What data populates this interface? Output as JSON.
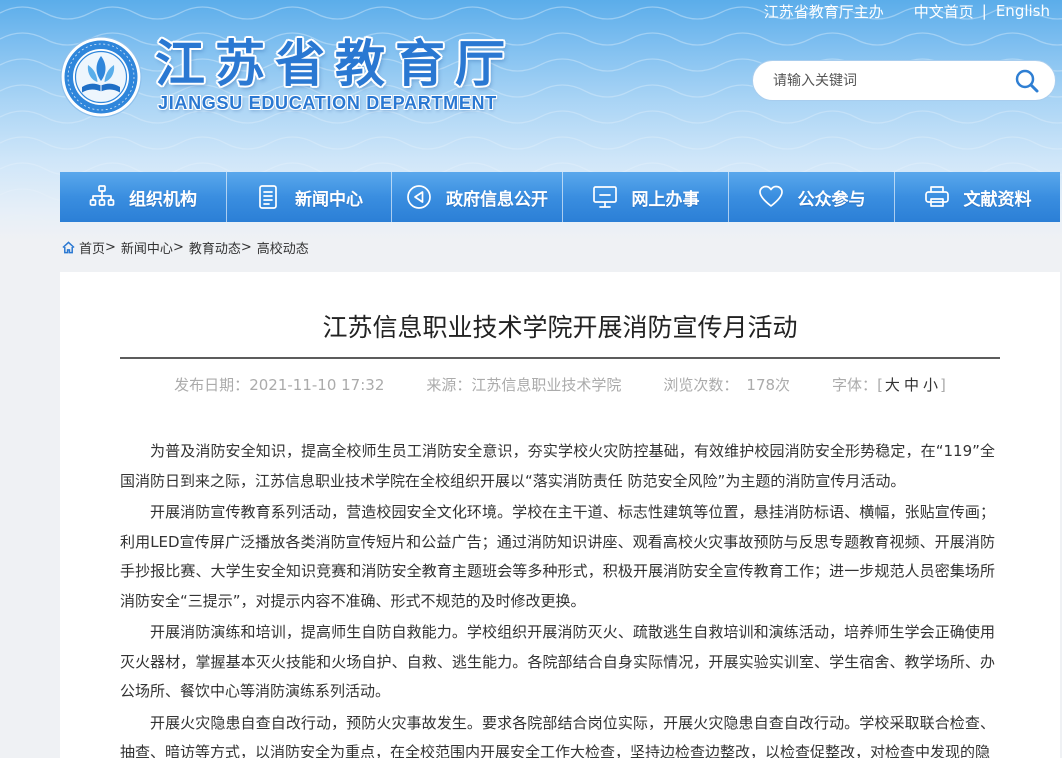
{
  "header": {
    "topbar": {
      "sponsor": "江苏省教育厅主办",
      "home_link": "中文首页",
      "divider": "|",
      "english_link": "English"
    },
    "logo": {
      "title": "江苏省教育厅",
      "subtitle": "JIANGSU EDUCATION DEPARTMENT",
      "emblem_icon": "education-department-emblem"
    },
    "search": {
      "placeholder": "请输入关键词",
      "value": "",
      "icon": "search-icon"
    }
  },
  "nav": {
    "items": [
      {
        "label": "组织机构",
        "icon": "org-chart-icon"
      },
      {
        "label": "新闻中心",
        "icon": "document-icon"
      },
      {
        "label": "政府信息公开",
        "icon": "info-disclosure-icon"
      },
      {
        "label": "网上办事",
        "icon": "monitor-icon"
      },
      {
        "label": "公众参与",
        "icon": "heart-icon"
      },
      {
        "label": "文献资料",
        "icon": "archive-icon"
      }
    ]
  },
  "breadcrumb": {
    "icon": "home-icon",
    "separator": ">",
    "items": [
      "首页",
      "新闻中心",
      "教育动态",
      "高校动态"
    ]
  },
  "article": {
    "title": "江苏信息职业技术学院开展消防宣传月活动",
    "meta": {
      "date_label": "发布日期：",
      "date": "2021-11-10 17:32",
      "source_label": "来源：",
      "source": "江苏信息职业技术学院",
      "views_label": "浏览次数：",
      "views": "178次",
      "font_label": "字体：",
      "font_bracket_open": "[",
      "font_sizes": [
        "大",
        "中",
        "小"
      ],
      "font_bracket_close": "]"
    },
    "paragraphs": [
      "为普及消防安全知识，提高全校师生员工消防安全意识，夯实学校火灾防控基础，有效维护校园消防安全形势稳定，在“119”全国消防日到来之际，江苏信息职业技术学院在全校组织开展以“落实消防责任 防范安全风险”为主题的消防宣传月活动。",
      "开展消防宣传教育系列活动，营造校园安全文化环境。学校在主干道、标志性建筑等位置，悬挂消防标语、横幅，张贴宣传画；利用LED宣传屏广泛播放各类消防宣传短片和公益广告；通过消防知识讲座、观看高校火灾事故预防与反思专题教育视频、开展消防手抄报比赛、大学生安全知识竞赛和消防安全教育主题班会等多种形式，积极开展消防安全宣传教育工作；进一步规范人员密集场所消防安全“三提示”，对提示内容不准确、形式不规范的及时修改更换。",
      "开展消防演练和培训，提高师生自防自救能力。学校组织开展消防灭火、疏散逃生自救培训和演练活动，培养师生学会正确使用灭火器材，掌握基本灭火技能和火场自护、自救、逃生能力。各院部结合自身实际情况，开展实验实训室、学生宿舍、教学场所、办公场所、餐饮中心等消防演练系列活动。",
      "开展火灾隐患自查自改行动，预防火灾事故发生。要求各院部结合岗位实际，开展火灾隐患自查自改行动。学校采取联合检查、抽查、暗访等方式，以消防安全为重点，在全校范围内开展安全工作大检查，坚持边检查边整改，以检查促整改，对检查中发现的隐"
    ]
  },
  "colors": {
    "brand_blue": "#2a78d2",
    "nav_top": "#5aa8ec",
    "nav_bottom": "#2b7fd6",
    "header_top": "#5badea",
    "page_background": "#eff1f4",
    "card_background": "#ffffff",
    "body_text": "#333333",
    "meta_text": "#ababab"
  }
}
